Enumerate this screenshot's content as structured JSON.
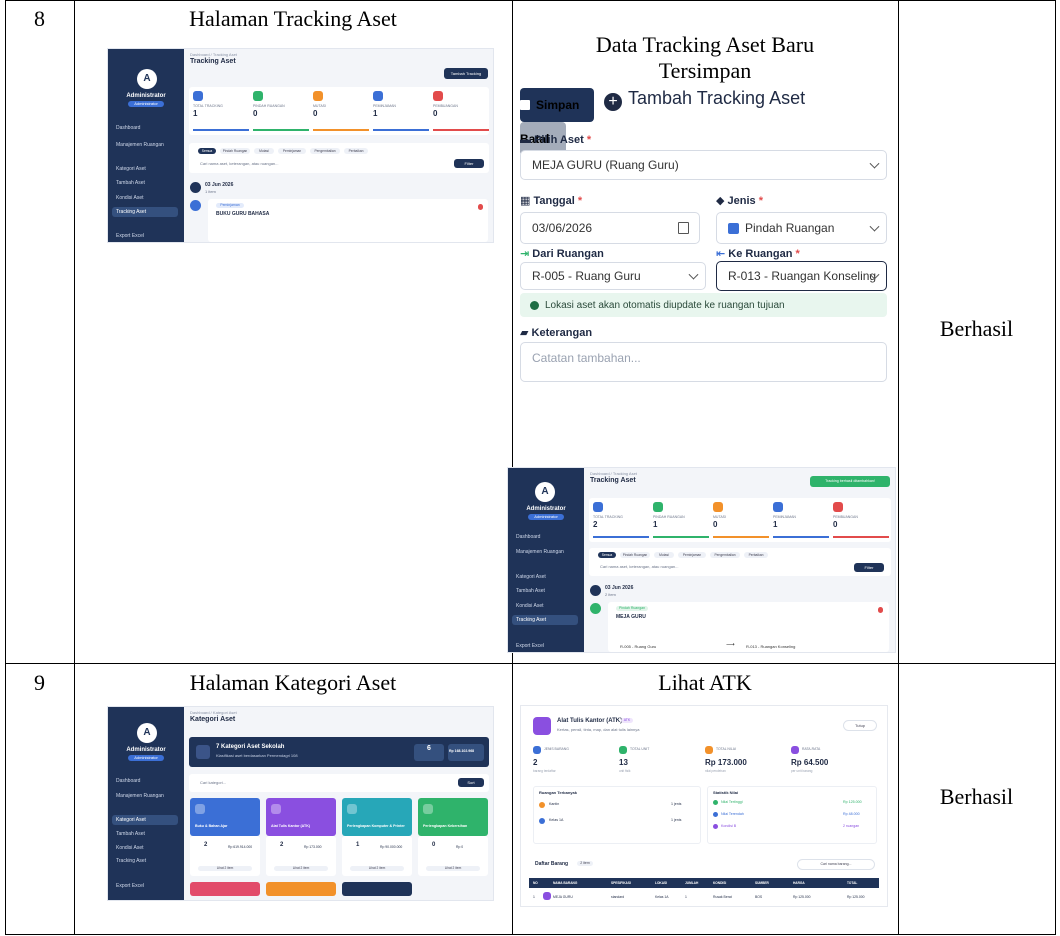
{
  "rows": [
    {
      "number": "8",
      "page_title": "Halaman Tracking Aset",
      "result_caption_line1": "Data Tracking Aset Baru",
      "result_caption_line2": "Tersimpan",
      "status": "Berhasil",
      "left_shot": {
        "user": "Administrator",
        "role": "Administrator",
        "crumb": "Dashboard / Tracking Aset",
        "title": "Tracking Aset",
        "add_button": "Tambah Tracking",
        "stats": [
          {
            "label": "TOTAL TRACKING",
            "value": "1",
            "color": "#3b6fd6"
          },
          {
            "label": "PINDAH RUANGAN",
            "value": "0",
            "color": "#2fb36b"
          },
          {
            "label": "MUTASI",
            "value": "0",
            "color": "#f2912a"
          },
          {
            "label": "PEMINJAMAN",
            "value": "1",
            "color": "#3b6fd6"
          },
          {
            "label": "PEMBUANGAN",
            "value": "0",
            "color": "#e24b4b"
          }
        ],
        "filters": [
          "Semua",
          "Pindah Ruangan",
          "Mutasi",
          "Peminjaman",
          "Pengembalian",
          "Perbaikan"
        ],
        "search_placeholder": "Cari nama aset, keterangan, atau ruangan...",
        "filter_button": "Filter",
        "date": "03 Jun 2026",
        "date_sub": "1 item",
        "event_tag": "Peminjaman",
        "event_title": "BUKU GURU BAHASA",
        "nav": [
          "Dashboard",
          "Manajemen Ruangan",
          "Kategori Aset",
          "Tambah Aset",
          "Kondisi Aset",
          "Tracking Aset",
          "Export Excel"
        ]
      },
      "form": {
        "header": "Tambah Tracking Aset",
        "asset_label": "Pilih Aset",
        "asset_value": "MEJA GURU (Ruang Guru)",
        "date_label": "Tanggal",
        "date_value": "03/06/2026",
        "type_label": "Jenis",
        "type_value": "Pindah Ruangan",
        "from_label": "Dari Ruangan",
        "from_value": "R-005 - Ruang Guru",
        "to_label": "Ke Ruangan",
        "to_value": "R-013 - Ruangan Konseling",
        "info": "Lokasi aset akan otomatis diupdate ke ruangan tujuan",
        "note_label": "Keterangan",
        "note_placeholder": "Catatan tambahan...",
        "save_button": "Simpan",
        "cancel_button": "Batal"
      },
      "right_shot": {
        "user": "Administrator",
        "role": "Administrator",
        "crumb": "Dashboard / Tracking Aset",
        "title": "Tracking Aset",
        "toast": "Tracking berhasil ditambahkan!",
        "stats": [
          {
            "label": "TOTAL TRACKING",
            "value": "2",
            "color": "#3b6fd6"
          },
          {
            "label": "PINDAH RUANGAN",
            "value": "1",
            "color": "#2fb36b"
          },
          {
            "label": "MUTASI",
            "value": "0",
            "color": "#f2912a"
          },
          {
            "label": "PEMINJAMAN",
            "value": "1",
            "color": "#3b6fd6"
          },
          {
            "label": "PEMBUANGAN",
            "value": "0",
            "color": "#e24b4b"
          }
        ],
        "filters": [
          "Semua",
          "Pindah Ruangan",
          "Mutasi",
          "Peminjaman",
          "Pengembalian",
          "Perbaikan"
        ],
        "search_placeholder": "Cari nama aset, keterangan, atau ruangan...",
        "filter_button": "Filter",
        "date": "03 Jun 2026",
        "date_sub": "2 item",
        "event_tag": "Pindah Ruangan",
        "event_title": "MEJA GURU",
        "from_room": "R-005 - Ruang Guru",
        "to_room": "R-013 - Ruangan Konseling",
        "nav": [
          "Dashboard",
          "Manajemen Ruangan",
          "Kategori Aset",
          "Tambah Aset",
          "Kondisi Aset",
          "Tracking Aset",
          "Export Excel"
        ]
      }
    },
    {
      "number": "9",
      "page_title": "Halaman Kategori Aset",
      "result_caption": "Lihat ATK",
      "status": "Berhasil",
      "left_shot": {
        "user": "Administrator",
        "role": "Administrator",
        "crumb": "Dashboard / Kategori Aset",
        "title": "Kategori Aset",
        "banner_title": "7 Kategori Aset Sekolah",
        "banner_sub": "Klasifikasi aset berdasarkan Permendagri 108",
        "banner_count": "6",
        "banner_total": "Rp 168.102.968",
        "search_placeholder": "Cari kategori...",
        "sort_button": "Sort",
        "categories": [
          {
            "name": "Buku & Bahan Ajar",
            "color": "#3b6fd6",
            "qty": "2",
            "value": "Rp 619.914.000"
          },
          {
            "name": "Alat Tulis Kantor (ATK)",
            "color": "#8a4fe0",
            "qty": "2",
            "value": "Rp 173.000"
          },
          {
            "name": "Perlengkapan Komputer & Printer",
            "color": "#27a7b8",
            "qty": "1",
            "value": "Rp 90.000.000"
          },
          {
            "name": "Perlengkapan Kebersihan",
            "color": "#2fb36b",
            "qty": "0",
            "value": "Rp 0"
          }
        ],
        "see_items": "Lihat 2 item",
        "nav": [
          "Dashboard",
          "Manajemen Ruangan",
          "Kategori Aset",
          "Tambah Aset",
          "Kondisi Aset",
          "Tracking Aset",
          "Export Excel"
        ]
      },
      "atk_shot": {
        "title": "Alat Tulis Kantor (ATK)",
        "tag": "ATK",
        "subtitle": "Kertas, pensil, tinta, map, dan alat tulis lainnya",
        "close": "Tutup",
        "stats": [
          {
            "label": "JENIS BARANG",
            "value": "2",
            "sub": "barang terdaftar",
            "color": "#3b6fd6"
          },
          {
            "label": "TOTAL UNIT",
            "value": "13",
            "sub": "unit fisik",
            "color": "#2fb36b"
          },
          {
            "label": "TOTAL NILAI",
            "value": "Rp 173.000",
            "sub": "nilai perolehan",
            "color": "#f2912a"
          },
          {
            "label": "RATA-RATA",
            "value": "Rp 64.500",
            "sub": "per unit barang",
            "color": "#8a4fe0"
          }
        ],
        "rooms_title": "Ruangan Terbanyak",
        "rooms": [
          {
            "name": "Kantin",
            "qty": "1 jenis"
          },
          {
            "name": "Kelas 1A",
            "qty": "1 jenis"
          }
        ],
        "value_title": "Statistik Nilai",
        "value_rows": [
          {
            "label": "Nilai Tertinggi",
            "value": "Rp 125.000"
          },
          {
            "label": "Nilai Terendah",
            "value": "Rp 48.000"
          },
          {
            "label": "Kondisi B",
            "value": "2 ruangan"
          }
        ],
        "list_title": "Daftar Barang",
        "list_count": "2 item",
        "list_search": "Cari nama barang...",
        "columns": [
          "NO",
          "NAMA BARANG",
          "SPESIFIKASI",
          "LOKASI",
          "JUMLAH",
          "KONDISI",
          "SUMBER",
          "HARGA",
          "TOTAL"
        ],
        "first_row": {
          "no": "1",
          "name": "MEJA GURU",
          "spec": "standard",
          "loc": "Kelas 1A",
          "qty": "1",
          "cond": "Rusak Berat",
          "src": "BOS",
          "price": "Rp 125.000",
          "total": "Rp 125.000"
        }
      }
    }
  ]
}
